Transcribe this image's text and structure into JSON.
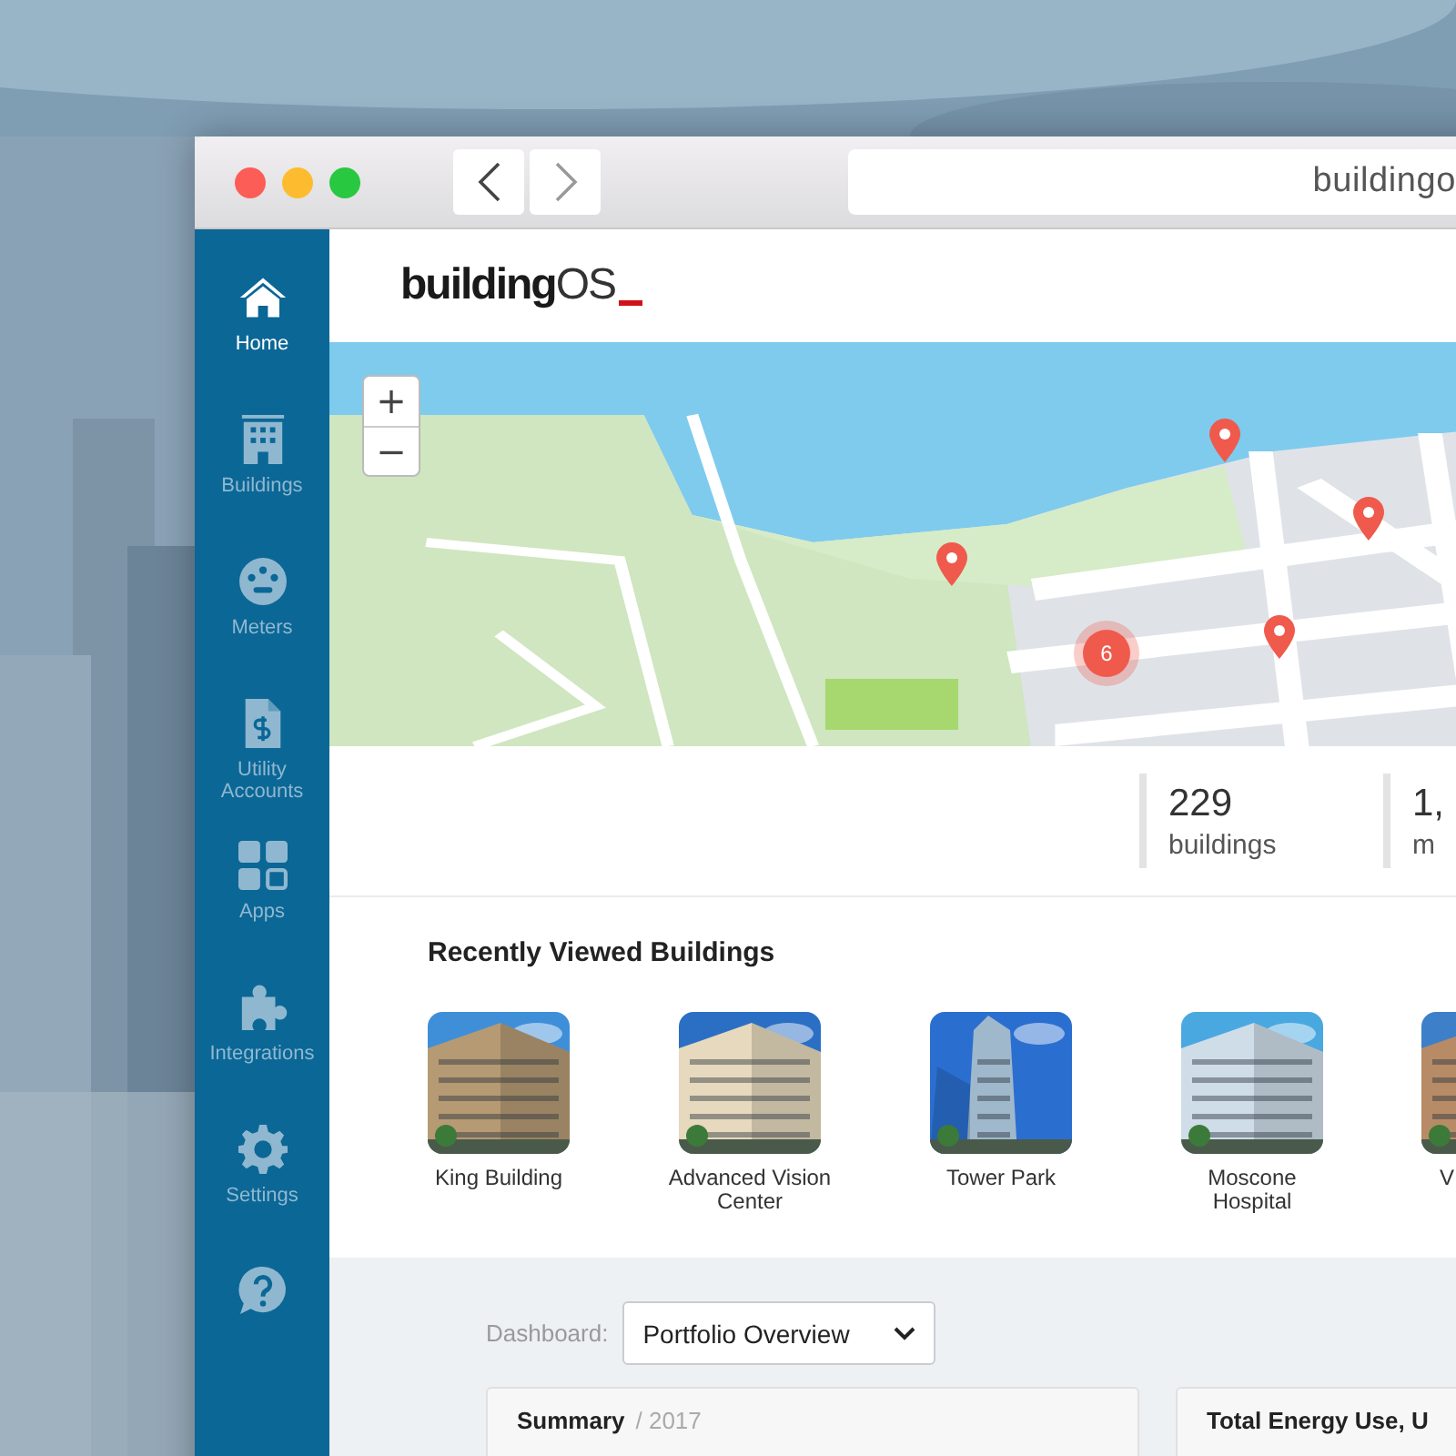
{
  "browser": {
    "address": "buildingo"
  },
  "logo": {
    "bold": "building",
    "light": "OS"
  },
  "sidebar": {
    "items": [
      {
        "label": "Home",
        "selected": true
      },
      {
        "label": "Buildings",
        "selected": false
      },
      {
        "label": "Meters",
        "selected": false
      },
      {
        "label": "Utility Accounts",
        "selected": false
      },
      {
        "label": "Apps",
        "selected": false
      },
      {
        "label": "Integrations",
        "selected": false
      },
      {
        "label": "Settings",
        "selected": false
      },
      {
        "selected": false
      }
    ]
  },
  "map": {
    "zoom_in": "+",
    "zoom_out": "−",
    "cluster": "6"
  },
  "stats": [
    {
      "value": "229",
      "label": "buildings"
    },
    {
      "value": "1,",
      "label": "m"
    }
  ],
  "recently_viewed": {
    "title": "Recently Viewed Buildings",
    "buildings": [
      {
        "name": "King Building"
      },
      {
        "name": "Advanced Vision Center"
      },
      {
        "name": "Tower Park"
      },
      {
        "name": "Moscone Hospital"
      },
      {
        "name": "V"
      }
    ]
  },
  "dashboard": {
    "label": "Dashboard:",
    "value": "Portfolio Overview"
  },
  "cards": [
    {
      "title": "Summary",
      "subtitle": "/ 2017"
    },
    {
      "title": "Total Energy Use, U"
    }
  ]
}
